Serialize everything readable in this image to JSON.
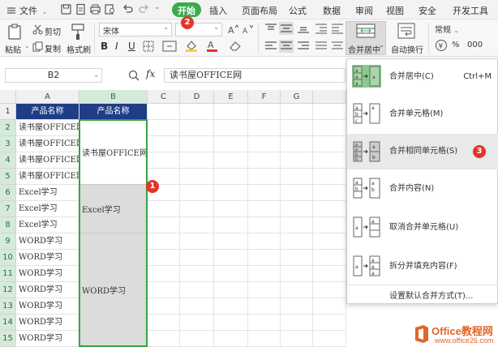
{
  "menubar": {
    "file_label": "文件",
    "tabs": [
      "开始",
      "插入",
      "页面布局",
      "公式",
      "数据",
      "审阅",
      "视图",
      "安全",
      "开发工具"
    ]
  },
  "ribbon": {
    "paste_label": "粘贴",
    "cut_label": "剪切",
    "copy_label": "复制",
    "format_painter_label": "格式刷",
    "font_name": "宋体",
    "merge_center_label": "合并居中",
    "wrap_text_label": "自动换行",
    "number_format": "常规"
  },
  "formula_bar": {
    "name_box": "B2",
    "fx": "fx",
    "content": "读书屋OFFICE网"
  },
  "grid": {
    "columns": [
      "A",
      "B",
      "C",
      "D",
      "E",
      "F",
      "G"
    ],
    "rows": [
      "1",
      "2",
      "3",
      "4",
      "5",
      "6",
      "7",
      "8",
      "9",
      "10",
      "11",
      "12",
      "13",
      "14",
      "15"
    ],
    "header_row": [
      "产品名称",
      "产品名称"
    ],
    "column_a": [
      "读书屋OFFICE网",
      "读书屋OFFICE网",
      "读书屋OFFICE网",
      "读书屋OFFICE网",
      "Excel学习",
      "Excel学习",
      "Excel学习",
      "WORD学习",
      "WORD学习",
      "WORD学习",
      "WORD学习",
      "WORD学习",
      "WORD学习",
      "WORD学习"
    ],
    "merged_b": [
      "读书屋OFFICE网",
      "Excel学习",
      "WORD学习"
    ]
  },
  "dropdown": {
    "items": [
      {
        "label": "合并居中(C)",
        "shortcut": "Ctrl+M"
      },
      {
        "label": "合并单元格(M)",
        "shortcut": ""
      },
      {
        "label": "合并相同单元格(S)",
        "shortcut": ""
      },
      {
        "label": "合并内容(N)",
        "shortcut": ""
      },
      {
        "label": "取消合并单元格(U)",
        "shortcut": ""
      },
      {
        "label": "拆分并填充内容(F)",
        "shortcut": ""
      }
    ],
    "footer": "设置默认合并方式(T)..."
  },
  "badges": [
    "1",
    "2",
    "3"
  ],
  "watermark": {
    "main": "Office教程网",
    "sub": "www.office26.com"
  },
  "colors": {
    "accent_green": "#3cab4e",
    "header_blue": "#1f3c86",
    "badge_red": "#e2362b"
  }
}
